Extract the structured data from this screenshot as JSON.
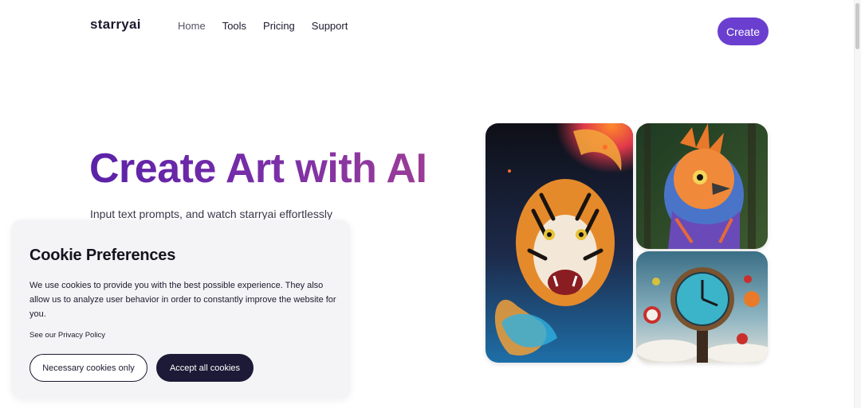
{
  "header": {
    "logo": "starryai",
    "nav": [
      {
        "label": "Home",
        "active": true
      },
      {
        "label": "Tools",
        "active": false
      },
      {
        "label": "Pricing",
        "active": false
      },
      {
        "label": "Support",
        "active": false
      }
    ],
    "create_label": "Create"
  },
  "hero": {
    "title": "Create Art with AI",
    "subtitle": "Input text prompts, and watch starryai effortlessly"
  },
  "gallery": [
    {
      "icon": "tiger-image"
    },
    {
      "icon": "bird-image"
    },
    {
      "icon": "clock-image"
    }
  ],
  "cookie": {
    "title": "Cookie Preferences",
    "text": "We use cookies to provide you with the best possible experience. They also allow us to analyze user behavior in order to constantly improve the website for you.",
    "privacy_link": "See our Privacy Policy",
    "necessary_label": "Necessary cookies only",
    "accept_label": "Accept all cookies"
  },
  "colors": {
    "accent": "#6a3fd0",
    "title_gradient_start": "#5a21a8",
    "title_gradient_end": "#9b3d96",
    "dark_button": "#1c1a36",
    "cookie_bg": "#f4f4f6"
  }
}
